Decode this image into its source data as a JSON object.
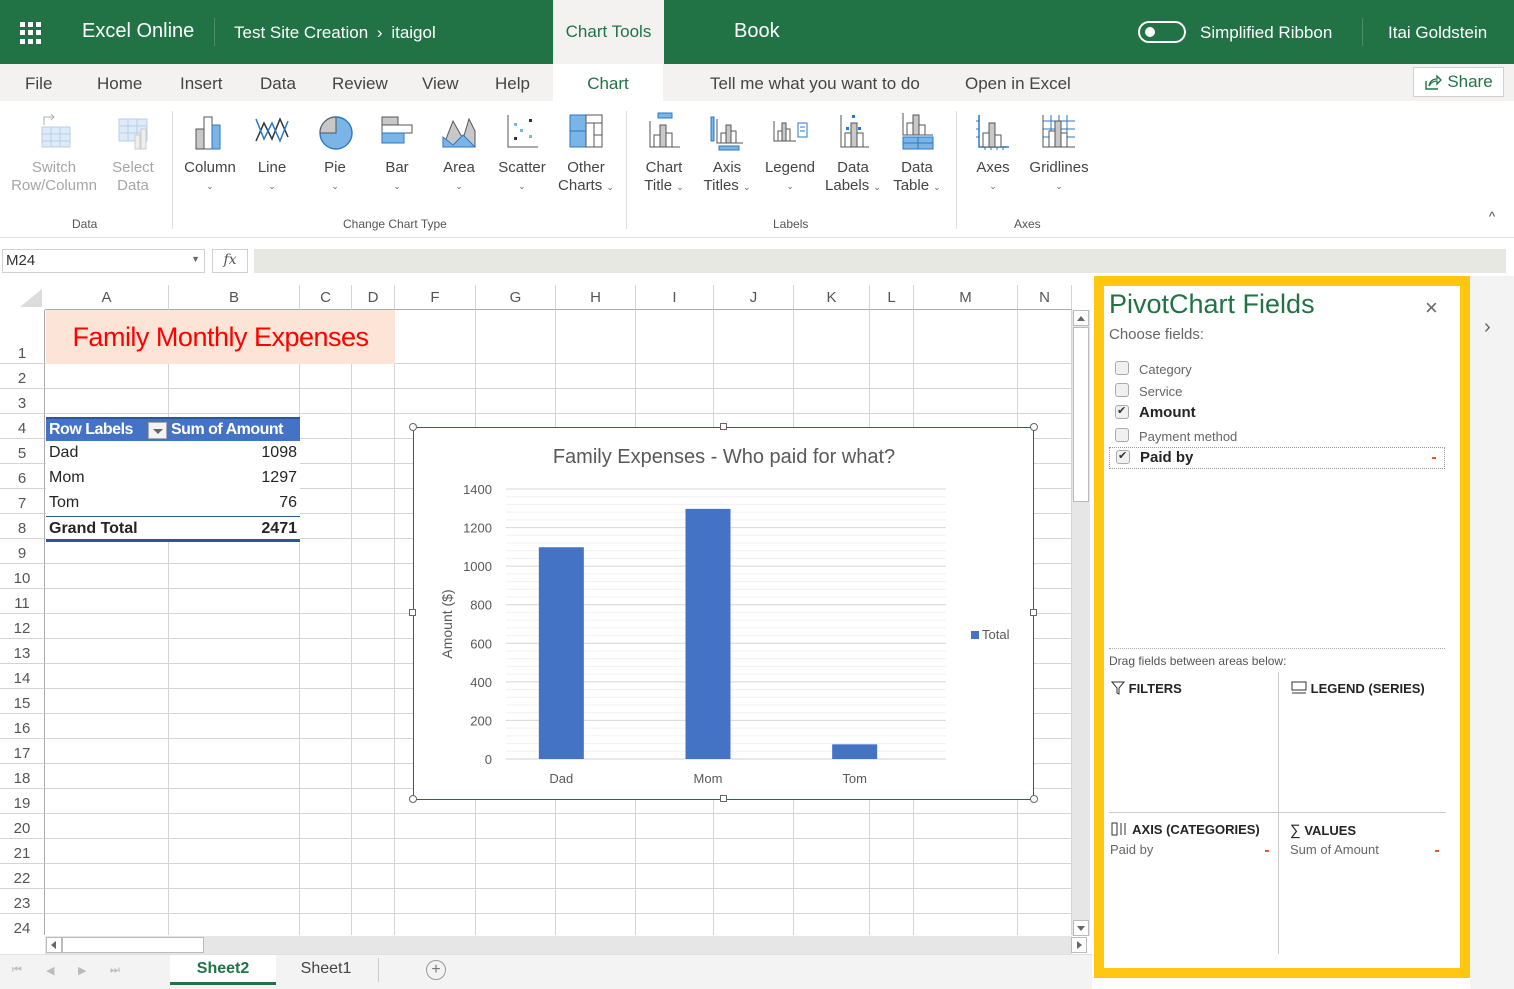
{
  "topbar": {
    "app_name": "Excel Online",
    "breadcrumb_site": "Test Site Creation",
    "breadcrumb_sep": "›",
    "breadcrumb_user": "itaigol",
    "context_tab": "Chart Tools",
    "book_title": "Book",
    "simplified_ribbon_label": "Simplified Ribbon",
    "simplified_ribbon_on": false,
    "user_name": "Itai Goldstein"
  },
  "menu": {
    "tabs": [
      "File",
      "Home",
      "Insert",
      "Data",
      "Review",
      "View",
      "Help",
      "Chart"
    ],
    "active_tab": "Chart",
    "tell_me": "Tell me what you want to do",
    "open_in_excel": "Open in Excel",
    "share": "Share"
  },
  "ribbon": {
    "groups": [
      {
        "label": "Data",
        "buttons": [
          {
            "line1": "Switch",
            "line2": "Row/Column",
            "icon": "switch-row-column-icon",
            "disabled": true
          },
          {
            "line1": "Select",
            "line2": "Data",
            "icon": "select-data-icon",
            "disabled": true
          }
        ]
      },
      {
        "label": "Change Chart Type",
        "buttons": [
          {
            "line1": "Column",
            "icon": "column-chart-icon"
          },
          {
            "line1": "Line",
            "icon": "line-chart-icon"
          },
          {
            "line1": "Pie",
            "icon": "pie-chart-icon"
          },
          {
            "line1": "Bar",
            "icon": "bar-chart-icon"
          },
          {
            "line1": "Area",
            "icon": "area-chart-icon"
          },
          {
            "line1": "Scatter",
            "icon": "scatter-chart-icon"
          },
          {
            "line1": "Other",
            "line2": "Charts",
            "icon": "other-charts-icon"
          }
        ]
      },
      {
        "label": "Labels",
        "buttons": [
          {
            "line1": "Chart",
            "line2": "Title",
            "icon": "chart-title-icon"
          },
          {
            "line1": "Axis",
            "line2": "Titles",
            "icon": "axis-titles-icon"
          },
          {
            "line1": "Legend",
            "icon": "legend-icon"
          },
          {
            "line1": "Data",
            "line2": "Labels",
            "icon": "data-labels-icon"
          },
          {
            "line1": "Data",
            "line2": "Table",
            "icon": "data-table-icon"
          }
        ]
      },
      {
        "label": "Axes",
        "buttons": [
          {
            "line1": "Axes",
            "icon": "axes-icon"
          },
          {
            "line1": "Gridlines",
            "icon": "gridlines-icon"
          }
        ]
      }
    ],
    "caret": "⌄",
    "collapse": "^"
  },
  "formula_bar": {
    "name_box": "M24",
    "fx": "fx",
    "formula": ""
  },
  "sheet": {
    "columns": [
      "A",
      "B",
      "C",
      "D",
      "F",
      "G",
      "H",
      "I",
      "J",
      "K",
      "L",
      "M",
      "N"
    ],
    "rows": [
      "1",
      "2",
      "3",
      "4",
      "5",
      "6",
      "7",
      "8",
      "9",
      "10",
      "11",
      "12",
      "13",
      "14",
      "15",
      "16",
      "17",
      "18",
      "19",
      "20",
      "21",
      "22",
      "23",
      "24"
    ],
    "title_cell": "Family Monthly Expenses",
    "pivot": {
      "header": [
        "Row Labels",
        "Sum of Amount"
      ],
      "rows": [
        {
          "label": "Dad",
          "value": "1098"
        },
        {
          "label": "Mom",
          "value": "1297"
        },
        {
          "label": "Tom",
          "value": "76"
        }
      ],
      "total": {
        "label": "Grand Total",
        "value": "2471"
      }
    }
  },
  "chart_data": {
    "type": "bar",
    "title": "Family Expenses - Who paid for what?",
    "categories": [
      "Dad",
      "Mom",
      "Tom"
    ],
    "series": [
      {
        "name": "Total",
        "values": [
          1098,
          1297,
          76
        ],
        "color": "#4472c4"
      }
    ],
    "xlabel": "",
    "ylabel": "Amount ($)",
    "ylim": [
      0,
      1400
    ],
    "yticks": [
      0,
      200,
      400,
      600,
      800,
      1000,
      1200,
      1400
    ],
    "grid": true,
    "legend": "right"
  },
  "sheet_tabs": {
    "tabs": [
      "Sheet2",
      "Sheet1"
    ],
    "active": "Sheet2",
    "add": "+"
  },
  "pivot_pane": {
    "title": "PivotChart Fields",
    "close": "×",
    "choose_label": "Choose fields:",
    "fields": [
      {
        "name": "Category",
        "checked": false
      },
      {
        "name": "Service",
        "checked": false
      },
      {
        "name": "Amount",
        "checked": true
      },
      {
        "name": "Payment method",
        "checked": false
      },
      {
        "name": "Paid by",
        "checked": true
      }
    ],
    "drag_hint": "Drag fields between areas below:",
    "areas": {
      "filters": {
        "label": "FILTERS",
        "items": []
      },
      "legend": {
        "label": "LEGEND (SERIES)",
        "items": []
      },
      "axis": {
        "label": "AXIS (CATEGORIES)",
        "items": [
          "Paid by"
        ]
      },
      "values": {
        "label": "VALUES",
        "items": [
          "Sum of Amount"
        ]
      }
    },
    "expand": "›"
  },
  "colors": {
    "brand": "#217346",
    "pane_highlight": "#ffc712",
    "pivot_header": "#4472c4",
    "title_fill": "#fce4d6",
    "title_text": "#ff0000"
  }
}
